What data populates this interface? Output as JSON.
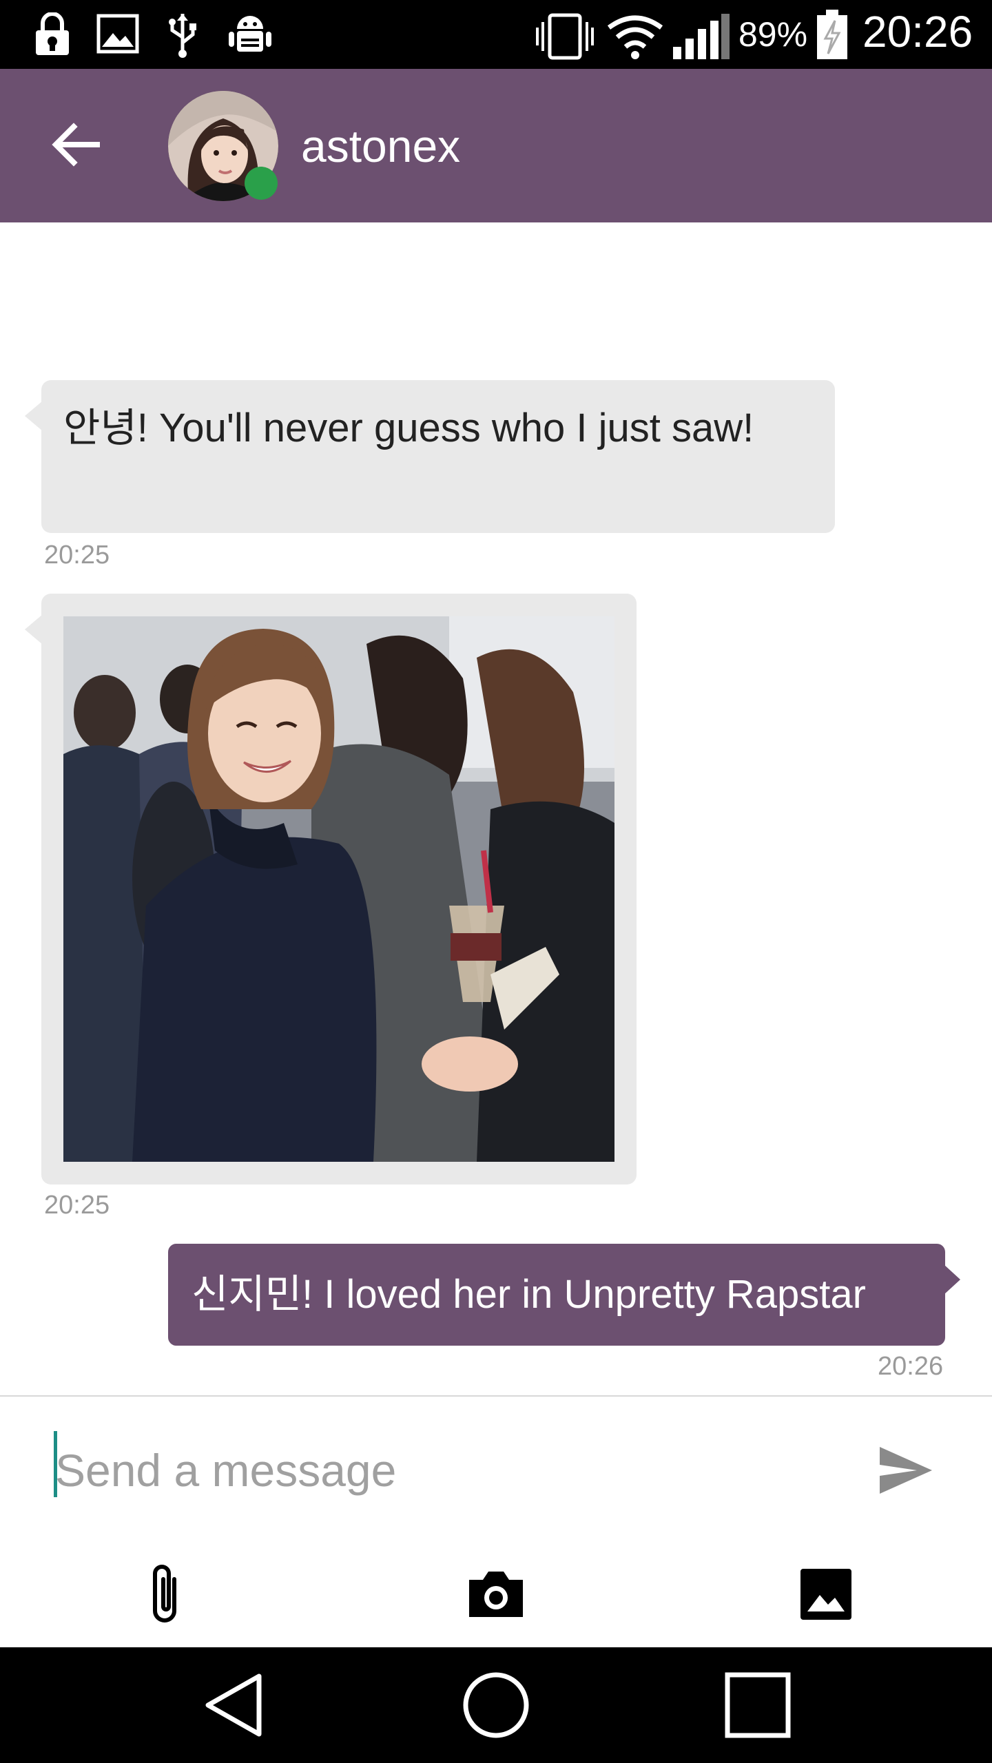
{
  "status_bar": {
    "battery_percent": "89%",
    "time": "20:26",
    "icons": [
      "lock-android-icon",
      "image-icon",
      "usb-icon",
      "android-debug-icon",
      "vibrate-icon",
      "wifi-icon",
      "signal-icon",
      "battery-charging-icon"
    ]
  },
  "toolbar": {
    "back_icon": "arrow-back-icon",
    "contact_name": "astonex",
    "presence": "online"
  },
  "messages": [
    {
      "direction": "incoming",
      "type": "text",
      "text": "안녕! You'll never guess who I just saw!",
      "time": "20:25"
    },
    {
      "direction": "incoming",
      "type": "image",
      "time": "20:25"
    },
    {
      "direction": "outgoing",
      "type": "text",
      "text": "신지민! I loved her in Unpretty Rapstar",
      "time": "20:26"
    }
  ],
  "composer": {
    "placeholder": "Send a message",
    "value": "",
    "send_icon": "send-icon"
  },
  "actions": [
    {
      "icon": "paperclip-icon"
    },
    {
      "icon": "camera-icon"
    },
    {
      "icon": "gallery-image-icon"
    }
  ],
  "nav_bar": {
    "icons": [
      "nav-back-icon",
      "nav-home-icon",
      "nav-recents-icon"
    ]
  },
  "colors": {
    "toolbar": "#6c5070",
    "incoming_bubble": "#e9e9e9",
    "outgoing_bubble": "#6c5070",
    "presence": "#2aa04a",
    "cursor": "#1d8e86"
  }
}
